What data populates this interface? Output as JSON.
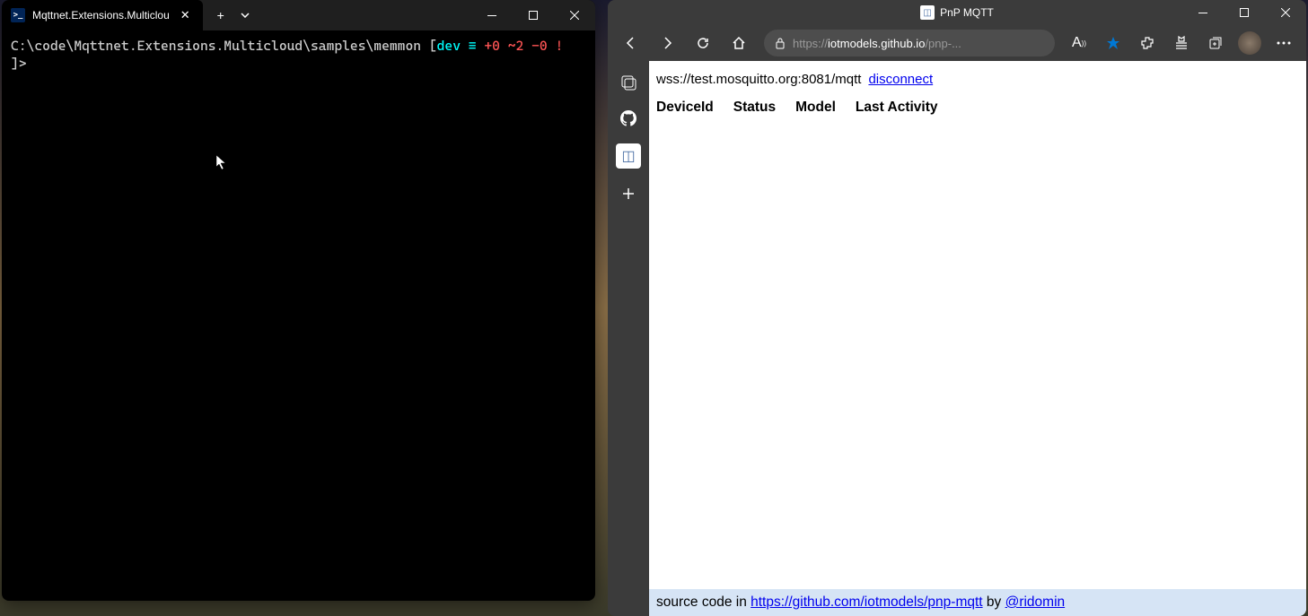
{
  "terminal": {
    "tab_title": "Mqttnet.Extensions.Multiclou",
    "prompt": {
      "path": "C:\\code\\Mqttnet.Extensions.Multicloud\\samples\\memmon",
      "branch": "dev",
      "equals": "≡",
      "plus": "+0",
      "tilde": "~2",
      "minus": "-0",
      "excl": "!",
      "arrow": "]>"
    }
  },
  "browser": {
    "title": "PnP MQTT",
    "url_protocol": "https://",
    "url_host": "iotmodels.github.io",
    "url_path": "/pnp-...",
    "page": {
      "conn_url": "wss://test.mosquitto.org:8081/mqtt",
      "disconnect_label": "disconnect",
      "headers": {
        "device_id": "DeviceId",
        "status": "Status",
        "model": "Model",
        "last_activity": "Last Activity"
      },
      "footer_prefix": "source code in ",
      "footer_repo": "https://github.com/iotmodels/pnp-mqtt",
      "footer_by": " by ",
      "footer_author": "@ridomin"
    }
  }
}
